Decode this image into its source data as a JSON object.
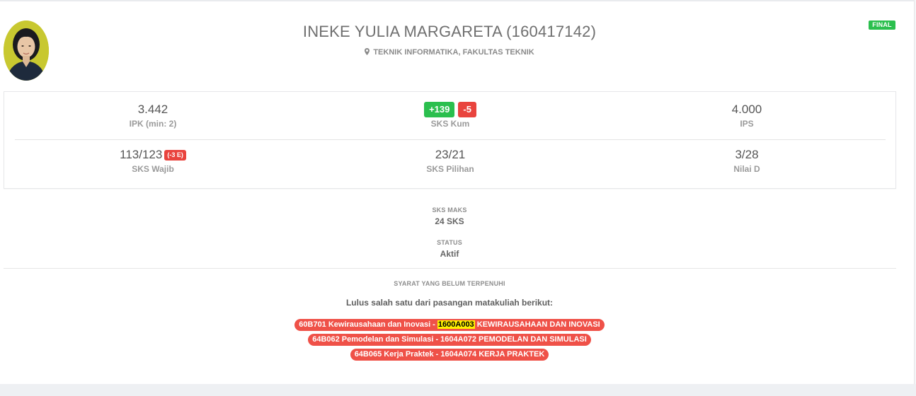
{
  "profile": {
    "name": "INEKE YULIA MARGARETA (160417142)",
    "program": "TEKNIK INFORMATIKA, FAKULTAS TEKNIK",
    "status_badge": "FINAL"
  },
  "stats": {
    "ipk": {
      "value": "3.442",
      "label": "IPK (min: 2)"
    },
    "sks_kum": {
      "plus": "+139",
      "minus": "-5",
      "label": "SKS Kum"
    },
    "ips": {
      "value": "4.000",
      "label": "IPS"
    },
    "sks_wajib": {
      "value": "113/123",
      "badge": "(-3 E)",
      "label": "SKS Wajib"
    },
    "sks_pilihan": {
      "value": "23/21",
      "label": "SKS Pilihan"
    },
    "nilai_d": {
      "value": "3/28",
      "label": "Nilai D"
    }
  },
  "sks_maks": {
    "label": "SKS MAKS",
    "value": "24 SKS"
  },
  "status": {
    "label": "STATUS",
    "value": "Aktif"
  },
  "requirements": {
    "heading": "SYARAT YANG BELUM TERPENUHI",
    "intro": "Lulus salah satu dari pasangan matakuliah berikut:",
    "items": [
      {
        "before": "60B701 Kewirausahaan dan Inovasi - ",
        "highlight": "1600A003",
        "after": " KEWIRAUSAHAAN DAN INOVASI"
      },
      {
        "before": "64B062 Pemodelan dan Simulasi - 1604A072 PEMODELAN DAN SIMULASI",
        "highlight": "",
        "after": ""
      },
      {
        "before": "64B065 Kerja Praktek - 1604A074 KERJA PRAKTEK",
        "highlight": "",
        "after": ""
      }
    ]
  },
  "colors": {
    "green": "#2bbf4e",
    "red": "#e9443e",
    "pill_red": "#ef5148",
    "highlight": "#fff200"
  }
}
